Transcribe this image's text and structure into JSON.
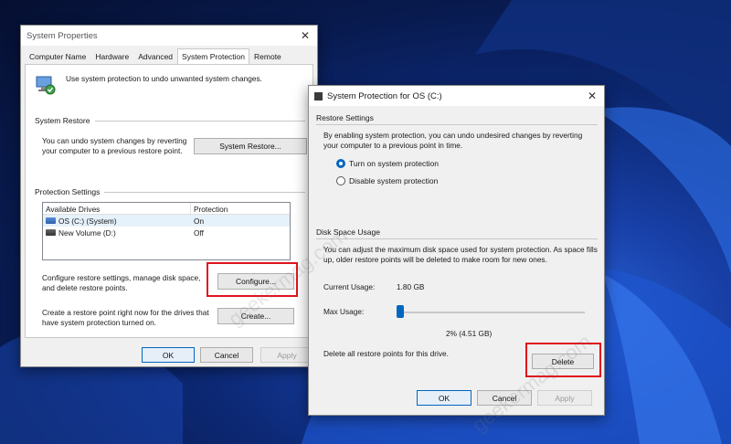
{
  "system_properties": {
    "title": "System Properties",
    "close_glyph": "✕",
    "tabs": [
      "Computer Name",
      "Hardware",
      "Advanced",
      "System Protection",
      "Remote"
    ],
    "active_tab": "System Protection",
    "intro_text": "Use system protection to undo unwanted system changes.",
    "system_restore": {
      "heading": "System Restore",
      "description": "You can undo system changes by reverting your computer to a previous restore point.",
      "button_label": "System Restore..."
    },
    "protection_settings": {
      "heading": "Protection Settings",
      "columns": [
        "Available Drives",
        "Protection"
      ],
      "rows": [
        {
          "drive": "OS (C:) (System)",
          "protection": "On",
          "icon": "os-drive-icon"
        },
        {
          "drive": "New Volume (D:)",
          "protection": "Off",
          "icon": "volume-drive-icon"
        }
      ],
      "configure_text": "Configure restore settings, manage disk space, and delete restore points.",
      "configure_button": "Configure...",
      "create_text": "Create a restore point right now for the drives that have system protection turned on.",
      "create_button": "Create..."
    },
    "footer": {
      "ok": "OK",
      "cancel": "Cancel",
      "apply": "Apply"
    }
  },
  "protection_dialog": {
    "title": "System Protection for OS (C:)",
    "close_glyph": "✕",
    "restore_settings": {
      "heading": "Restore Settings",
      "description": "By enabling system protection, you can undo undesired changes by reverting your computer to a previous point in time.",
      "options": [
        {
          "label": "Turn on system protection",
          "selected": true
        },
        {
          "label": "Disable system protection",
          "selected": false
        }
      ]
    },
    "disk_space": {
      "heading": "Disk Space Usage",
      "description": "You can adjust the maximum disk space used for system protection. As space fills up, older restore points will be deleted to make room for new ones.",
      "current_usage_label": "Current Usage:",
      "current_usage_value": "1.80 GB",
      "max_usage_label": "Max Usage:",
      "max_usage_percent": 2,
      "max_usage_readout": "2% (4.51 GB)",
      "delete_text": "Delete all restore points for this drive.",
      "delete_button": "Delete"
    },
    "footer": {
      "ok": "OK",
      "cancel": "Cancel",
      "apply": "Apply"
    }
  },
  "watermark": "geekermag.com",
  "colors": {
    "accent": "#0067c0",
    "highlight_box": "#e0141c"
  }
}
